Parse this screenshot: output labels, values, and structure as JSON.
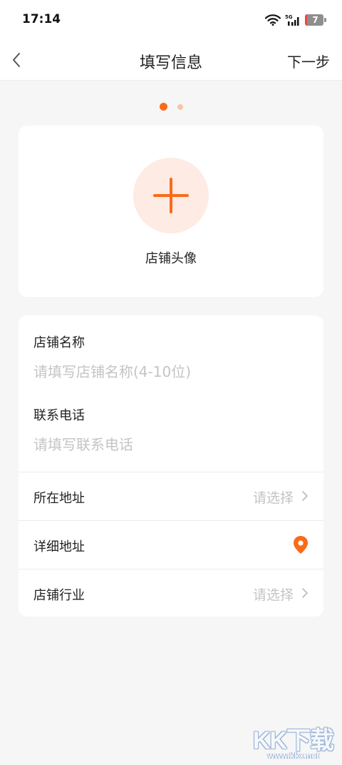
{
  "status_bar": {
    "time": "17:14",
    "network": "5G",
    "battery_level": "7",
    "icons": [
      "wifi-icon",
      "cellular-signal-icon",
      "battery-icon"
    ]
  },
  "nav": {
    "back_icon": "chevron-left-icon",
    "title": "填写信息",
    "next_label": "下一步"
  },
  "pager": {
    "total": 2,
    "active_index": 0
  },
  "avatar_section": {
    "icon": "plus-icon",
    "label": "店铺头像"
  },
  "form": {
    "store_name": {
      "label": "店铺名称",
      "placeholder": "请填写店铺名称(4-10位)",
      "value": ""
    },
    "phone": {
      "label": "联系电话",
      "placeholder": "请填写联系电话",
      "value": ""
    },
    "rows": [
      {
        "label": "所在地址",
        "value": "请选择",
        "icon": "chevron-right-icon"
      },
      {
        "label": "详细地址",
        "value": "",
        "icon": "location-pin-icon"
      },
      {
        "label": "店铺行业",
        "value": "请选择",
        "icon": "chevron-right-icon"
      }
    ]
  },
  "watermark": {
    "brand": "KK下载",
    "url": "www.kkx.net"
  },
  "colors": {
    "accent": "#fa6b18",
    "accent_light": "#fdebe4",
    "background": "#f6f6f6",
    "placeholder": "#c4c4c4"
  }
}
